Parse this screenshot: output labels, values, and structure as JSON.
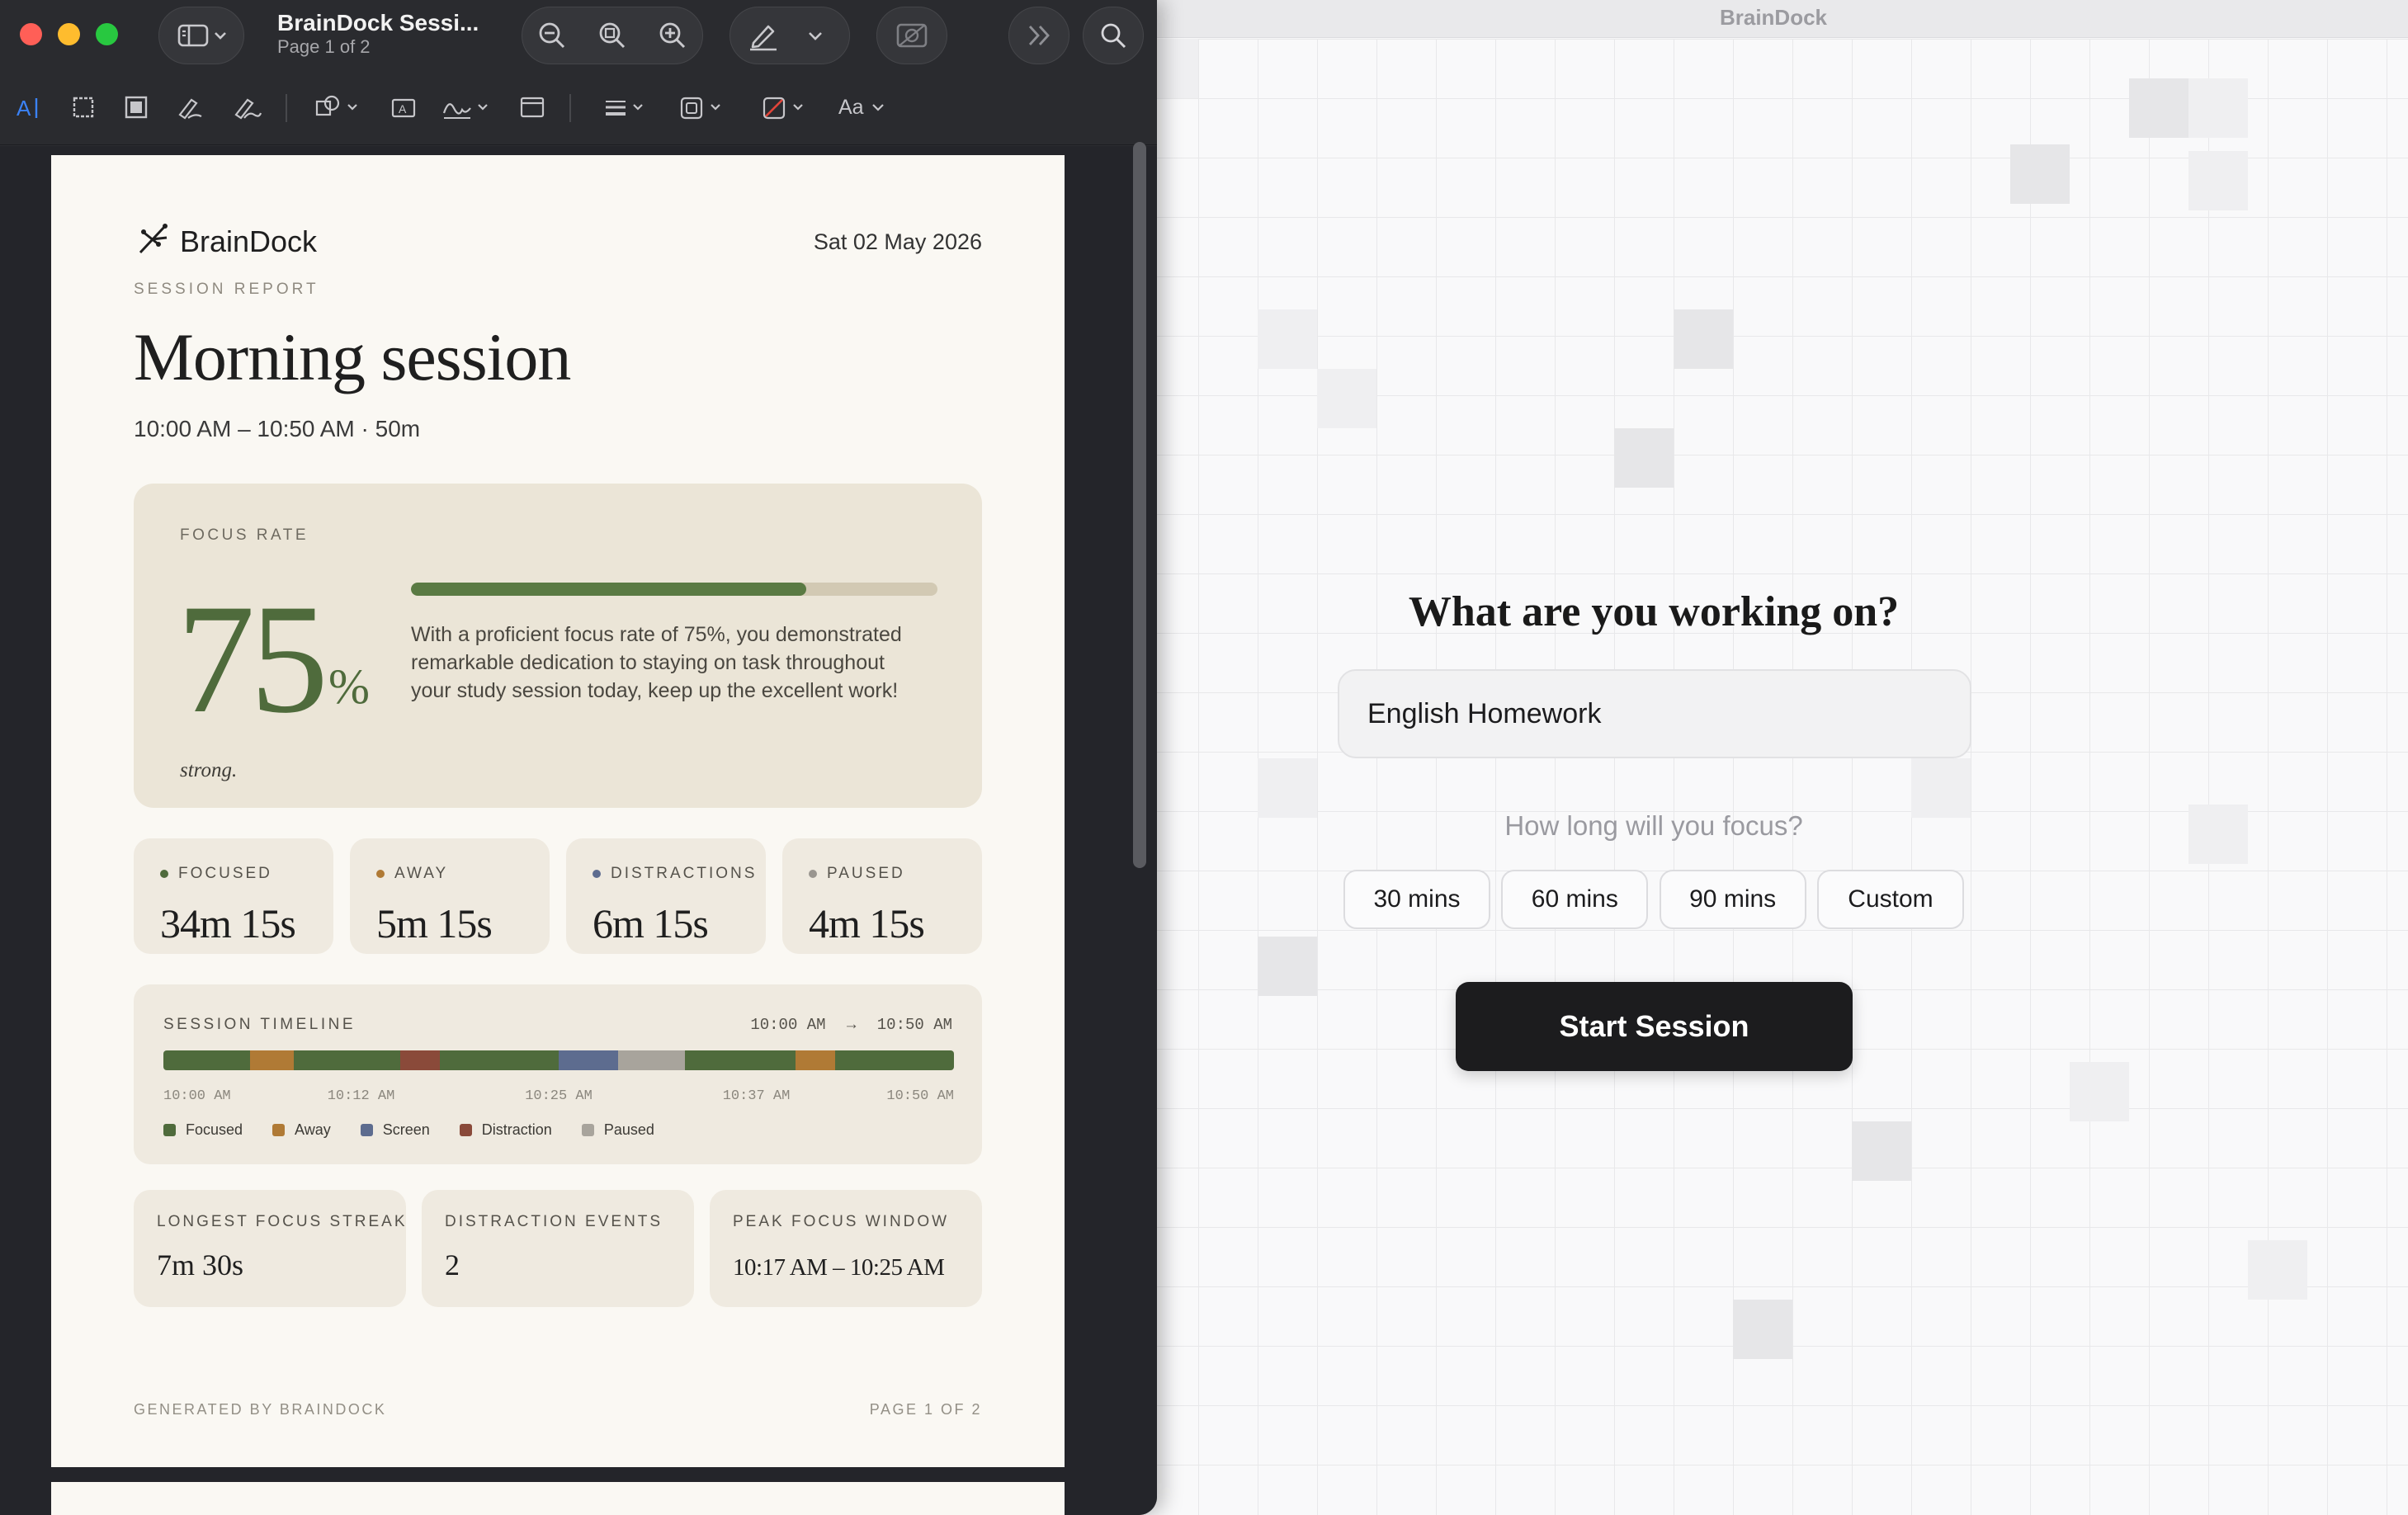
{
  "app": {
    "title": "BrainDock",
    "prompt": "What are you working on?",
    "task_value": "English Homework",
    "duration_prompt": "How long will you focus?",
    "durations": [
      {
        "label": "30 mins"
      },
      {
        "label": "60 mins"
      },
      {
        "label": "90 mins"
      },
      {
        "label": "Custom"
      }
    ],
    "start_label": "Start Session"
  },
  "preview": {
    "doc_name": "BrainDock Sessi...",
    "page_indicator": "Page 1 of 2",
    "toolbar_icons": [
      "sidebar-icon",
      "zoom-out-icon",
      "zoom-fit-icon",
      "zoom-in-icon",
      "markup-pen-icon",
      "chevron-down-icon",
      "image-edit-icon",
      "more-chevrons-icon",
      "search-icon"
    ],
    "markup_icons": [
      "text-selection-icon",
      "rect-selection-icon",
      "redact-icon",
      "sketch-icon",
      "draw-icon",
      "shapes-icon",
      "text-box-icon",
      "signature-icon",
      "note-icon",
      "line-style-icon",
      "border-color-icon",
      "fill-color-icon",
      "font-icon"
    ],
    "font_tool_label": "Aa"
  },
  "report": {
    "brand": "BrainDock",
    "date": "Sat 02 May 2026",
    "kicker": "SESSION REPORT",
    "title": "Morning session",
    "time_range": "10:00 AM – 10:50 AM · 50m",
    "focus": {
      "label": "FOCUS RATE",
      "value": "75",
      "unit": "%",
      "rate": 0.75,
      "description": "With a proficient focus rate of 75%, you demonstrated remarkable dedication to staying on task throughout your study session today, keep up the excellent work!",
      "rating": "strong."
    },
    "stats": [
      {
        "label": "FOCUSED",
        "value": "34m 15s",
        "color": "#4f6b3c"
      },
      {
        "label": "AWAY",
        "value": "5m 15s",
        "color": "#b07a35"
      },
      {
        "label": "DISTRACTIONS",
        "value": "6m 15s",
        "color": "#5d6c8f"
      },
      {
        "label": "PAUSED",
        "value": "4m 15s",
        "color": "#9a9690"
      }
    ],
    "timeline": {
      "label": "SESSION TIMELINE",
      "start": "10:00 AM",
      "arrow": "→",
      "end": "10:50 AM",
      "ticks": [
        "10:00 AM",
        "10:12 AM",
        "10:25 AM",
        "10:37 AM",
        "10:50 AM"
      ],
      "segments": [
        {
          "type": "Focused",
          "fraction": 0.11
        },
        {
          "type": "Away",
          "fraction": 0.055
        },
        {
          "type": "Focused",
          "fraction": 0.135
        },
        {
          "type": "Distraction",
          "fraction": 0.05
        },
        {
          "type": "Focused",
          "fraction": 0.15
        },
        {
          "type": "Screen",
          "fraction": 0.075
        },
        {
          "type": "Paused",
          "fraction": 0.085
        },
        {
          "type": "Focused",
          "fraction": 0.14
        },
        {
          "type": "Away",
          "fraction": 0.05
        },
        {
          "type": "Focused",
          "fraction": 0.15
        }
      ],
      "legend": [
        {
          "label": "Focused",
          "color": "#4f6b3c"
        },
        {
          "label": "Away",
          "color": "#b07a35"
        },
        {
          "label": "Screen",
          "color": "#5d6c8f"
        },
        {
          "label": "Distraction",
          "color": "#8a4a3a"
        },
        {
          "label": "Paused",
          "color": "#a8a49c"
        }
      ]
    },
    "metrics": [
      {
        "label": "LONGEST FOCUS STREAK",
        "value": "7m 30s"
      },
      {
        "label": "DISTRACTION EVENTS",
        "value": "2"
      },
      {
        "label": "PEAK FOCUS WINDOW",
        "value": "10:17 AM – 10:25 AM"
      }
    ],
    "footer_left": "GENERATED BY BRAINDOCK",
    "footer_right": "PAGE 1 OF 2"
  }
}
